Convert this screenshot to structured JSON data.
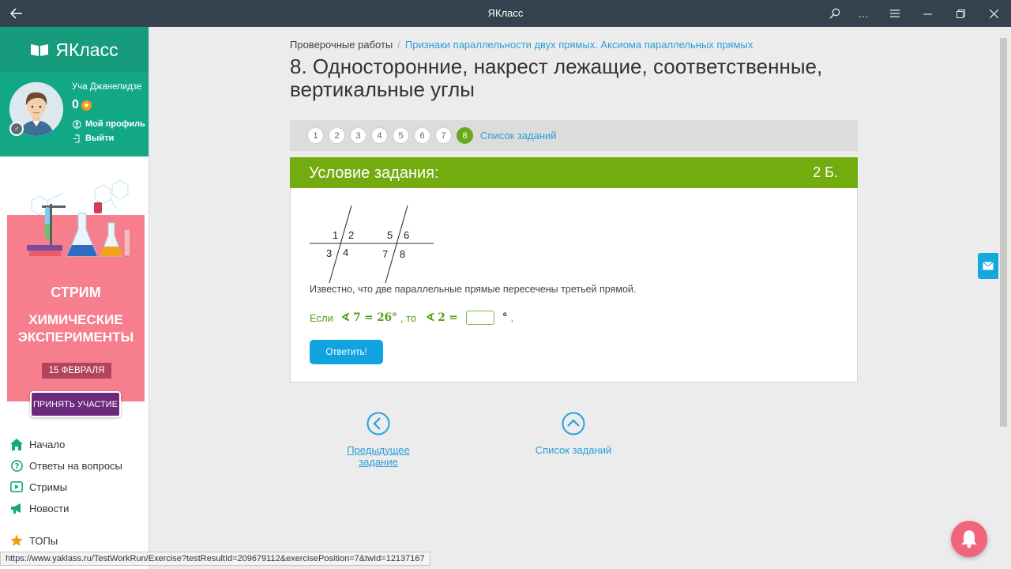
{
  "window": {
    "title": "ЯКласс"
  },
  "sidebar": {
    "logo": "ЯКласс",
    "user": {
      "name": "Уча Джанелидзе",
      "points": "0",
      "profile_link": "Мой профиль",
      "logout_link": "Выйти"
    },
    "promo": {
      "line1": "СТРИМ",
      "line2": "ХИМИЧЕСКИЕ",
      "line3": "ЭКСПЕРИМЕНТЫ",
      "date": "15 ФЕВРАЛЯ",
      "button": "ПРИНЯТЬ УЧАСТИЕ"
    },
    "nav": [
      {
        "label": "Начало",
        "icon": "home-icon",
        "color": "#12a886"
      },
      {
        "label": "Ответы на вопросы",
        "icon": "question-icon",
        "color": "#12a886"
      },
      {
        "label": "Стримы",
        "icon": "play-icon",
        "color": "#12a886"
      },
      {
        "label": "Новости",
        "icon": "megaphone-icon",
        "color": "#12a886"
      },
      {
        "label": "ТОПы",
        "icon": "star-icon",
        "color": "#f39c12"
      }
    ]
  },
  "breadcrumb": {
    "root": "Проверочные работы",
    "current": "Признаки параллельности двух прямых. Аксиома параллельных прямых"
  },
  "page_title": "8. Односторонние, накрест лежащие, соответственные, вертикальные углы",
  "pager": {
    "pages": [
      "1",
      "2",
      "3",
      "4",
      "5",
      "6",
      "7",
      "8"
    ],
    "active": "8",
    "list_link": "Список заданий"
  },
  "task": {
    "header": "Условие задания:",
    "points": "2 Б.",
    "figure_labels": [
      "1",
      "2",
      "3",
      "4",
      "5",
      "6",
      "7",
      "8"
    ],
    "statement": "Известно, что две параллельные прямые пересечены третьей прямой.",
    "equation": {
      "if": "Если",
      "angle": "∢",
      "given": "7 = 26°",
      "then": ", то",
      "target": "2 =",
      "degree": "°",
      "period": "."
    },
    "submit": "Ответить!"
  },
  "bottom_nav": {
    "prev": "Предыдущее задание",
    "list": "Список заданий"
  },
  "status_url": "https://www.yaklass.ru/TestWorkRun/Exercise?testResultId=209679112&exercisePosition=7&twId=12137167",
  "colors": {
    "titlebar": "#34424f",
    "brand": "#12a886",
    "task_header": "#72ac0e",
    "link": "#2a9fd8",
    "active_page": "#6aa81c"
  }
}
